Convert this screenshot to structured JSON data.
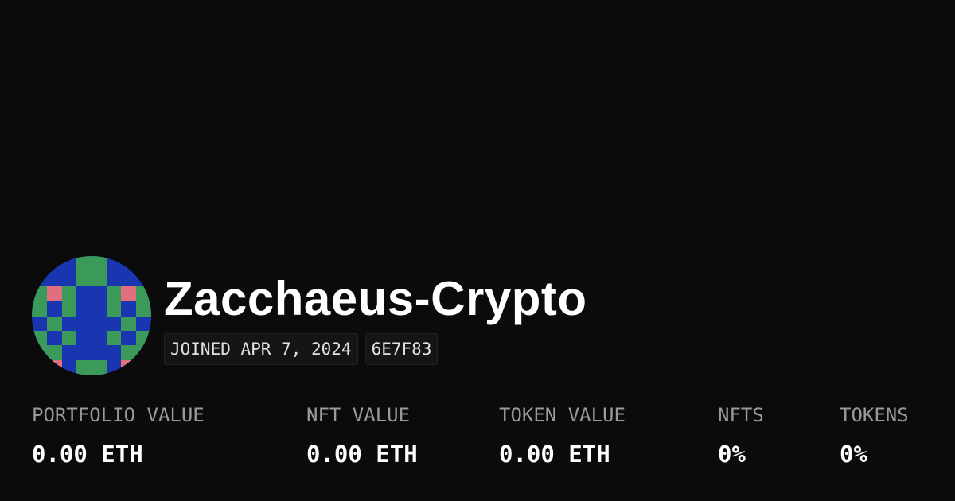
{
  "profile": {
    "username": "Zacchaeus-Crypto",
    "joined": "JOINED APR 7, 2024",
    "address_short": "6E7F83",
    "avatar_colors": {
      "blue": "#1a35b0",
      "green": "#3b9a5a",
      "pink": "#e07080"
    }
  },
  "stats": [
    {
      "label": "PORTFOLIO VALUE",
      "value": "0.00 ETH"
    },
    {
      "label": "NFT VALUE",
      "value": "0.00 ETH"
    },
    {
      "label": "TOKEN VALUE",
      "value": "0.00 ETH"
    },
    {
      "label": "NFTS",
      "value": "0%"
    },
    {
      "label": "TOKENS",
      "value": "0%"
    }
  ]
}
